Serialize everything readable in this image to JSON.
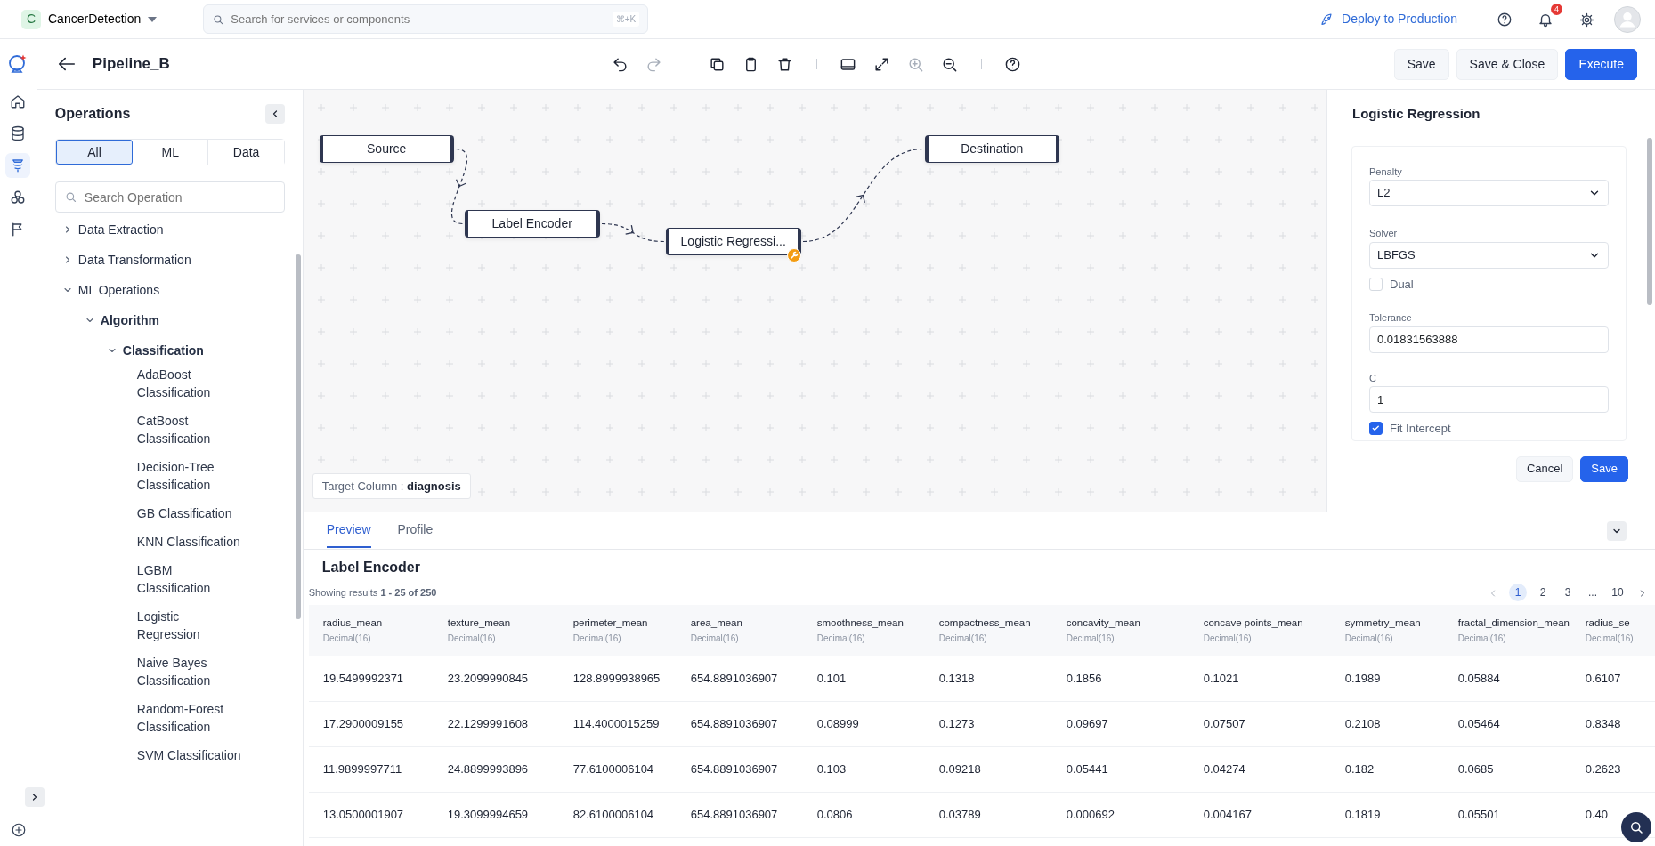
{
  "app": {
    "initial": "C",
    "name": "CancerDetection"
  },
  "search": {
    "placeholder": "Search for services or components",
    "shortcut": "⌘+K"
  },
  "header": {
    "deploy": "Deploy to Production",
    "notification_count": "4"
  },
  "rail": [
    {
      "kind": "home",
      "selected": false
    },
    {
      "kind": "database",
      "selected": false
    },
    {
      "kind": "pipeline",
      "selected": true
    },
    {
      "kind": "models",
      "selected": false
    },
    {
      "kind": "flag",
      "selected": false
    }
  ],
  "pipeline": {
    "title": "Pipeline_B"
  },
  "toolbar": [
    {
      "kind": "undo",
      "disabled": false
    },
    {
      "kind": "redo",
      "disabled": true
    },
    {
      "kind": "separator"
    },
    {
      "kind": "copy",
      "disabled": false
    },
    {
      "kind": "paste",
      "disabled": false
    },
    {
      "kind": "delete",
      "disabled": false
    },
    {
      "kind": "separator"
    },
    {
      "kind": "panel",
      "disabled": false
    },
    {
      "kind": "expand",
      "disabled": false
    },
    {
      "kind": "zoom-in",
      "disabled": true
    },
    {
      "kind": "zoom-out",
      "disabled": false
    },
    {
      "kind": "separator"
    },
    {
      "kind": "help",
      "disabled": false
    }
  ],
  "actions": [
    {
      "label": "Save",
      "kind": "secondary"
    },
    {
      "label": "Save & Close",
      "kind": "secondary"
    },
    {
      "label": "Execute",
      "kind": "primary"
    }
  ],
  "operations": {
    "title": "Operations",
    "filters": [
      {
        "label": "All",
        "selected": true
      },
      {
        "label": "ML",
        "selected": false
      },
      {
        "label": "Data",
        "selected": false
      }
    ],
    "search_placeholder": "Search Operation",
    "tree": [
      {
        "label": "Data Extraction",
        "expanded": false
      },
      {
        "label": "Data Transformation",
        "expanded": false
      },
      {
        "label": "ML Operations",
        "expanded": true,
        "children": [
          {
            "label": "Algorithm",
            "expanded": true,
            "children": [
              {
                "label": "Classification",
                "expanded": true,
                "children": [
                  {
                    "label": "AdaBoost Classification"
                  },
                  {
                    "label": "CatBoost Classification"
                  },
                  {
                    "label": "Decision-Tree Classification"
                  },
                  {
                    "label": "GB Classification"
                  },
                  {
                    "label": "KNN Classification"
                  },
                  {
                    "label": "LGBM Classification"
                  },
                  {
                    "label": "Logistic Regression"
                  },
                  {
                    "label": "Naive Bayes Classification"
                  },
                  {
                    "label": "Random-Forest Classification"
                  },
                  {
                    "label": "SVM Classification"
                  }
                ]
              }
            ]
          }
        ]
      }
    ]
  },
  "canvas": {
    "nodes": [
      {
        "label": "Source",
        "needs_config": false
      },
      {
        "label": "Label Encoder",
        "needs_config": false
      },
      {
        "label": "Logistic Regressi...",
        "needs_config": true
      },
      {
        "label": "Destination",
        "needs_config": false
      }
    ],
    "target_column": {
      "label": "Target Column :",
      "value": "diagnosis"
    }
  },
  "config_panel": {
    "title": "Logistic Regression",
    "fields": [
      {
        "kind": "select",
        "label": "Penalty",
        "value": "L2"
      },
      {
        "kind": "select",
        "label": "Solver",
        "value": "LBFGS"
      },
      {
        "kind": "checkbox",
        "label": "Dual",
        "checked": false
      },
      {
        "kind": "input",
        "label": "Tolerance",
        "value": "0.01831563888"
      },
      {
        "kind": "input",
        "label": "C",
        "value": "1"
      },
      {
        "kind": "checkbox",
        "label": "Fit Intercept",
        "checked": true
      }
    ],
    "buttons": [
      {
        "label": "Cancel",
        "kind": "secondary"
      },
      {
        "label": "Save",
        "kind": "primary"
      }
    ]
  },
  "results": {
    "tabs": [
      {
        "label": "Preview",
        "selected": true
      },
      {
        "label": "Profile",
        "selected": false
      }
    ],
    "title": "Label Encoder",
    "summary": "Showing results **1 - 25 of 250**",
    "pagination": [
      {
        "label": "1",
        "selected": true
      },
      {
        "label": "2",
        "selected": false
      },
      {
        "label": "3",
        "selected": false
      },
      {
        "label": "...",
        "selected": false
      },
      {
        "label": "10",
        "selected": false
      }
    ],
    "table": {
      "columns": [
        {
          "name": "radius_mean",
          "type": "Decimal(16)"
        },
        {
          "name": "texture_mean",
          "type": "Decimal(16)"
        },
        {
          "name": "perimeter_mean",
          "type": "Decimal(16)"
        },
        {
          "name": "area_mean",
          "type": "Decimal(16)"
        },
        {
          "name": "smoothness_mean",
          "type": "Decimal(16)"
        },
        {
          "name": "compactness_mean",
          "type": "Decimal(16)"
        },
        {
          "name": "concavity_mean",
          "type": "Decimal(16)"
        },
        {
          "name": "concave points_mean",
          "type": "Decimal(16)"
        },
        {
          "name": "symmetry_mean",
          "type": "Decimal(16)"
        },
        {
          "name": "fractal_dimension_mean",
          "type": "Decimal(16)"
        },
        {
          "name": "radius_se",
          "type": "Decimal(16)"
        }
      ],
      "rows": [
        [
          "19.5499992371",
          "23.2099990845",
          "128.8999938965",
          "654.8891036907",
          "0.101",
          "0.1318",
          "0.1856",
          "0.1021",
          "0.1989",
          "0.05884",
          "0.6107"
        ],
        [
          "17.2900009155",
          "22.1299991608",
          "114.4000015259",
          "654.8891036907",
          "0.08999",
          "0.1273",
          "0.09697",
          "0.07507",
          "0.2108",
          "0.05464",
          "0.8348"
        ],
        [
          "11.9899997711",
          "24.8899993896",
          "77.6100006104",
          "654.8891036907",
          "0.103",
          "0.09218",
          "0.05441",
          "0.04274",
          "0.182",
          "0.0685",
          "0.2623"
        ],
        [
          "13.0500001907",
          "19.3099994659",
          "82.6100006104",
          "654.8891036907",
          "0.0806",
          "0.03789",
          "0.000692",
          "0.004167",
          "0.1819",
          "0.05501",
          "0.40"
        ]
      ]
    }
  }
}
